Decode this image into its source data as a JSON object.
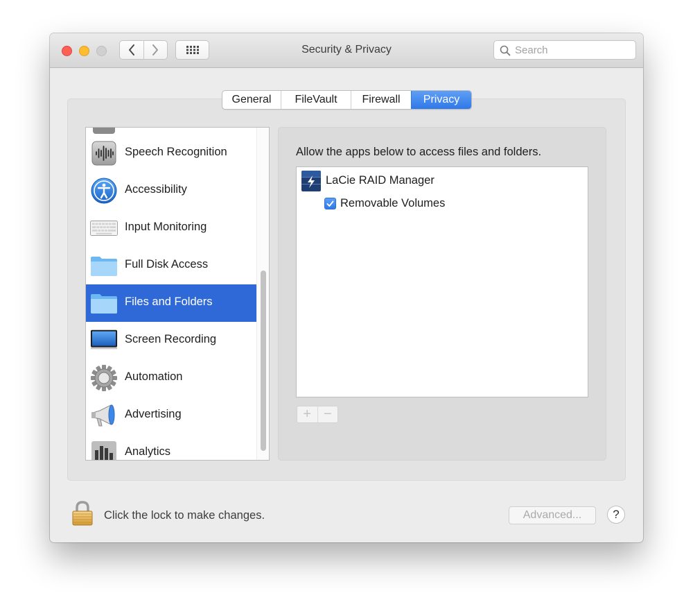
{
  "window": {
    "title": "Security & Privacy",
    "search_placeholder": "Search"
  },
  "tabs": [
    {
      "label": "General",
      "active": false
    },
    {
      "label": "FileVault",
      "active": false
    },
    {
      "label": "Firewall",
      "active": false
    },
    {
      "label": "Privacy",
      "active": true
    }
  ],
  "sidebar": {
    "items": [
      {
        "label": "Speech Recognition",
        "icon": "waveform-icon",
        "selected": false
      },
      {
        "label": "Accessibility",
        "icon": "accessibility-icon",
        "selected": false
      },
      {
        "label": "Input Monitoring",
        "icon": "keyboard-icon",
        "selected": false
      },
      {
        "label": "Full Disk Access",
        "icon": "folder-icon",
        "selected": false
      },
      {
        "label": "Files and Folders",
        "icon": "folder-icon",
        "selected": true
      },
      {
        "label": "Screen Recording",
        "icon": "display-icon",
        "selected": false
      },
      {
        "label": "Automation",
        "icon": "gear-icon",
        "selected": false
      },
      {
        "label": "Advertising",
        "icon": "megaphone-icon",
        "selected": false
      },
      {
        "label": "Analytics",
        "icon": "bar-chart-icon",
        "selected": false
      }
    ]
  },
  "detail": {
    "description": "Allow the apps below to access files and folders.",
    "apps": [
      {
        "name": "LaCie RAID Manager",
        "icon": "lacie-raid-icon",
        "permissions": [
          {
            "label": "Removable Volumes",
            "checked": true
          }
        ]
      }
    ],
    "add_label": "+",
    "remove_label": "−"
  },
  "footer": {
    "lock_text": "Click the lock to make changes.",
    "advanced_label": "Advanced...",
    "help_label": "?"
  },
  "colors": {
    "accent": "#2f69d7",
    "tab_active": "#3b82ee",
    "close": "#fe5f57",
    "minimize": "#febc2e"
  }
}
